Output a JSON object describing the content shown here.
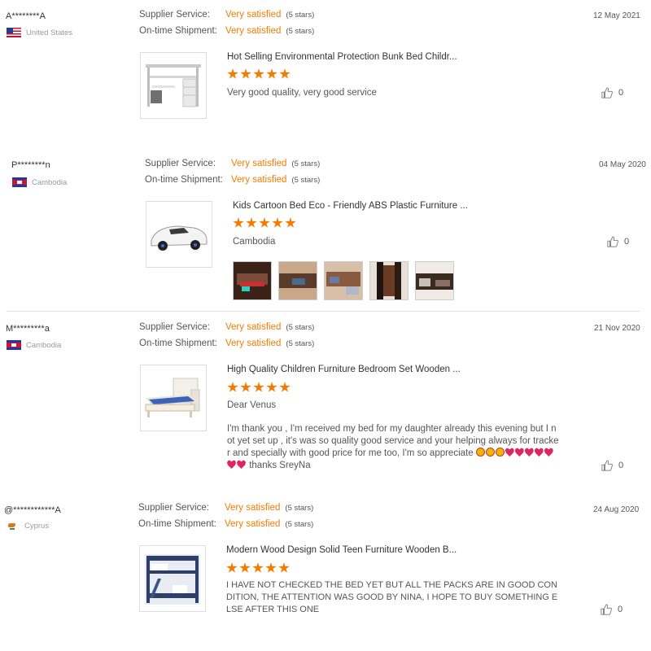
{
  "labels": {
    "supplier_service": "Supplier Service:",
    "ontime_shipment": "On-time Shipment:",
    "rating_value": "Very satisfied",
    "rating_stars": "(5 stars)"
  },
  "reviews": [
    {
      "buyer": "A********A",
      "country": "United States",
      "date": "12 May 2021",
      "product_title": "Hot Selling Environmental Protection Bunk Bed Childr...",
      "review_text": "Very good quality, very good service",
      "likes": "0"
    },
    {
      "buyer": "P********n",
      "country": "Cambodia",
      "date": "04 May 2020",
      "product_title": "Kids Cartoon Bed Eco - Friendly ABS Plastic Furniture ...",
      "review_text": "Cambodia",
      "likes": "0"
    },
    {
      "buyer": "M*********a",
      "country": "Cambodia",
      "date": "21 Nov 2020",
      "product_title": "High Quality Children Furniture Bedroom Set Wooden ...",
      "review_greeting": "Dear Venus",
      "review_text": "I'm thank you , I'm received my bed for my daughter already this evening but I not yet set up , it's was so quality good service and your helping always for tracker and specially with good price for me too, I'm so appreciate",
      "review_tail": "thanks SreyNa",
      "likes": "0"
    },
    {
      "buyer": "@************A",
      "country": "Cyprus",
      "date": "24 Aug 2020",
      "product_title": "Modern Wood Design Solid Teen Furniture Wooden B...",
      "review_text": "I HAVE NOT CHECKED THE BED YET BUT ALL THE PACKS ARE IN GOOD CONDITION, THE ATTENTION WAS GOOD BY NINA, I HOPE TO BUY SOMETHING ELSE AFTER THIS ONE",
      "likes": "0"
    }
  ],
  "colors": {
    "accent": "#f47b00",
    "text": "#333333",
    "muted": "#999999"
  },
  "icons": {
    "like": "thumbs-up-icon",
    "star": "star-icon"
  }
}
